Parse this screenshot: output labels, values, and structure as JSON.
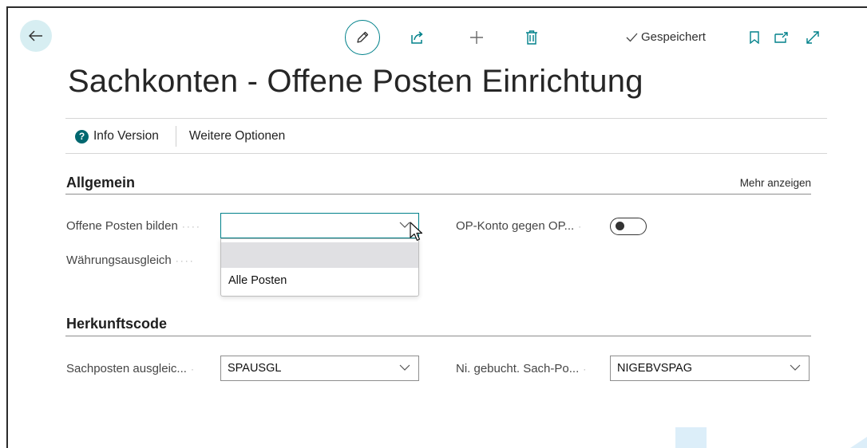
{
  "header": {
    "saved_label": "Gespeichert",
    "title": "Sachkonten - Offene Posten Einrichtung"
  },
  "actions": {
    "info_version": "Info Version",
    "more_options": "Weitere Optionen"
  },
  "general": {
    "title": "Allgemein",
    "show_more": "Mehr anzeigen",
    "open_entries_label": "Offene Posten bilden",
    "open_entries_value": "",
    "currency_label": "Währungsausgleich",
    "op_account_label": "OP-Konto gegen OP...",
    "op_account_enabled": false,
    "dropdown_options": [
      "",
      "Alle Posten"
    ]
  },
  "source_code": {
    "title": "Herkunftscode",
    "gl_apply_label": "Sachposten ausgleic...",
    "gl_apply_value": "SPAUSGL",
    "unposted_label": "Ni. gebucht. Sach-Po...",
    "unposted_value": "NIGEBVSPAG"
  },
  "colors": {
    "accent": "#00818a",
    "back_bg": "#d7eef2",
    "info_icon": "#00676f"
  }
}
